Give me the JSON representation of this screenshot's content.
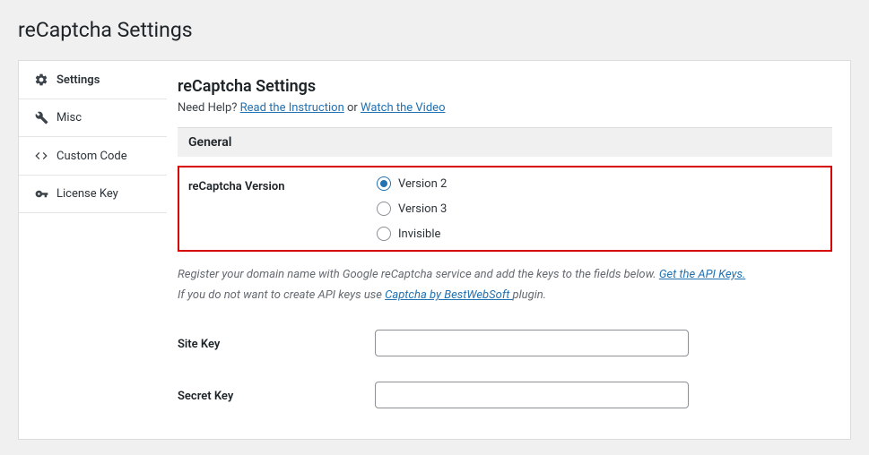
{
  "page_title": "reCaptcha Settings",
  "sidebar": {
    "items": [
      {
        "label": "Settings"
      },
      {
        "label": "Misc"
      },
      {
        "label": "Custom Code"
      },
      {
        "label": "License Key"
      }
    ]
  },
  "content": {
    "title": "reCaptcha Settings",
    "help_prefix": "Need Help? ",
    "help_link1": "Read the Instruction",
    "help_or": " or ",
    "help_link2": "Watch the Video",
    "section_general": "General",
    "version_label": "reCaptcha Version",
    "version_options": {
      "v2": "Version 2",
      "v3": "Version 3",
      "inv": "Invisible"
    },
    "desc_line1_a": "Register your domain name with Google reCaptcha service and add the keys to the fields below. ",
    "desc_link1": "Get the API Keys.",
    "desc_line2_a": "If you do not want to create API keys use ",
    "desc_link2": "Captcha by BestWebSoft ",
    "desc_line2_b": "plugin.",
    "site_key_label": "Site Key",
    "secret_key_label": "Secret Key"
  }
}
